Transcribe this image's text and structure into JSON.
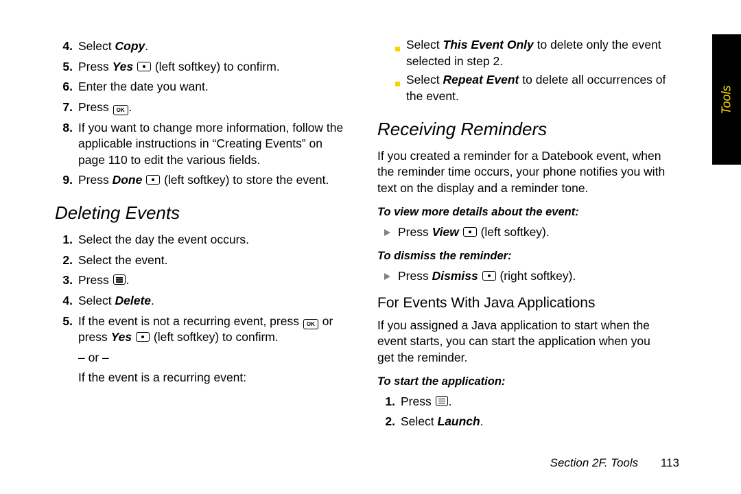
{
  "tabLabel": "Tools",
  "footer": {
    "section": "Section 2F. Tools",
    "page": "113"
  },
  "leftCol": {
    "topSteps": [
      {
        "n": "4.",
        "parts": [
          {
            "t": "Select "
          },
          {
            "t": "Copy",
            "cls": "bold-italic"
          },
          {
            "t": "."
          }
        ]
      },
      {
        "n": "5.",
        "parts": [
          {
            "t": "Press "
          },
          {
            "t": "Yes",
            "cls": "bold-italic"
          },
          {
            "t": " "
          },
          {
            "icon": "sk"
          },
          {
            "t": " (left softkey) to confirm."
          }
        ]
      },
      {
        "n": "6.",
        "parts": [
          {
            "t": "Enter the date you want."
          }
        ]
      },
      {
        "n": "7.",
        "parts": [
          {
            "t": "Press "
          },
          {
            "icon": "ok"
          },
          {
            "t": "."
          }
        ]
      },
      {
        "n": "8.",
        "parts": [
          {
            "t": "If you want to change more information, follow the applicable instructions in “Creating Events” on page 110 to edit the various fields."
          }
        ]
      },
      {
        "n": "9.",
        "parts": [
          {
            "t": "Press "
          },
          {
            "t": "Done",
            "cls": "bold-italic"
          },
          {
            "t": " "
          },
          {
            "icon": "sk"
          },
          {
            "t": " (left softkey) to store the event."
          }
        ]
      }
    ],
    "heading1": "Deleting Events",
    "delSteps": [
      {
        "n": "1.",
        "parts": [
          {
            "t": "Select the day the event occurs."
          }
        ]
      },
      {
        "n": "2.",
        "parts": [
          {
            "t": "Select the event."
          }
        ]
      },
      {
        "n": "3.",
        "parts": [
          {
            "t": "Press "
          },
          {
            "icon": "menu"
          },
          {
            "t": "."
          }
        ]
      },
      {
        "n": "4.",
        "parts": [
          {
            "t": "Select "
          },
          {
            "t": "Delete",
            "cls": "bold-italic"
          },
          {
            "t": "."
          }
        ]
      },
      {
        "n": "5.",
        "parts": [
          {
            "t": "If the event is not a recurring event, press "
          },
          {
            "icon": "ok"
          },
          {
            "t": " or press "
          },
          {
            "t": "Yes",
            "cls": "bold-italic"
          },
          {
            "t": " "
          },
          {
            "icon": "sk"
          },
          {
            "t": " (left softkey) to confirm."
          }
        ]
      }
    ],
    "orLine": "– or –",
    "recurLine": "If the event is a recurring event:"
  },
  "rightCol": {
    "topBullets": [
      {
        "parts": [
          {
            "t": "Select "
          },
          {
            "t": "This Event Only",
            "cls": "bold-italic"
          },
          {
            "t": " to delete only the event selected in step 2."
          }
        ]
      },
      {
        "parts": [
          {
            "t": "Select "
          },
          {
            "t": "Repeat Event",
            "cls": "bold-italic"
          },
          {
            "t": " to delete all occurrences of the event."
          }
        ]
      }
    ],
    "heading2": "Receiving Reminders",
    "para1": "If you created a reminder for a Datebook event, when the reminder time occurs, your phone notifies you with text on the display and a reminder tone.",
    "sub1": "To view more details about the event:",
    "arrow1": {
      "parts": [
        {
          "t": "Press "
        },
        {
          "t": "View",
          "cls": "bold-italic"
        },
        {
          "t": " "
        },
        {
          "icon": "sk"
        },
        {
          "t": " (left softkey)."
        }
      ]
    },
    "sub2": "To dismiss the reminder:",
    "arrow2": {
      "parts": [
        {
          "t": "Press "
        },
        {
          "t": "Dismiss",
          "cls": "bold-italic"
        },
        {
          "t": " "
        },
        {
          "icon": "sk"
        },
        {
          "t": " (right softkey)."
        }
      ]
    },
    "heading3": "For Events With Java Applications",
    "para2": "If you assigned a Java application to start when the event starts, you can start the application when you get the reminder.",
    "sub3": "To start the application:",
    "appSteps": [
      {
        "n": "1.",
        "parts": [
          {
            "t": "Press "
          },
          {
            "icon": "menu"
          },
          {
            "t": "."
          }
        ]
      },
      {
        "n": "2.",
        "parts": [
          {
            "t": "Select "
          },
          {
            "t": "Launch",
            "cls": "bold-italic"
          },
          {
            "t": "."
          }
        ]
      }
    ]
  }
}
